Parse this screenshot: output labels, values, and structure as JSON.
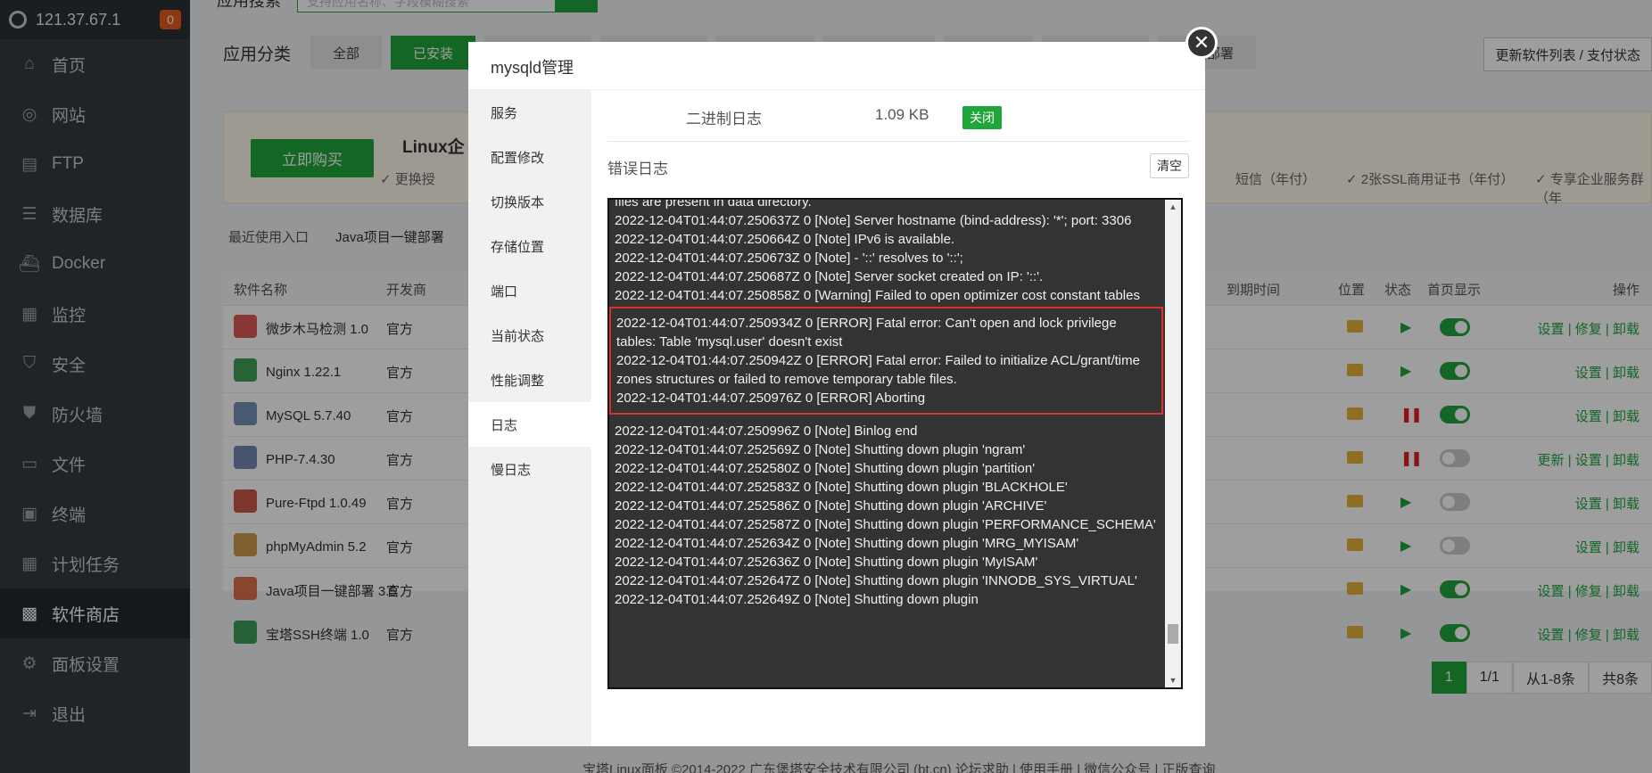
{
  "sidebar": {
    "ip": "121.37.67.1",
    "badge": "0",
    "items": [
      {
        "label": "首页",
        "icon": "home-icon"
      },
      {
        "label": "网站",
        "icon": "globe-icon"
      },
      {
        "label": "FTP",
        "icon": "ftp-icon"
      },
      {
        "label": "数据库",
        "icon": "database-icon"
      },
      {
        "label": "Docker",
        "icon": "docker-icon"
      },
      {
        "label": "监控",
        "icon": "monitor-icon"
      },
      {
        "label": "安全",
        "icon": "shield-check-icon"
      },
      {
        "label": "防火墙",
        "icon": "firewall-icon"
      },
      {
        "label": "文件",
        "icon": "folder-icon"
      },
      {
        "label": "终端",
        "icon": "terminal-icon"
      },
      {
        "label": "计划任务",
        "icon": "calendar-icon"
      },
      {
        "label": "软件商店",
        "icon": "grid-icon"
      },
      {
        "label": "面板设置",
        "icon": "gear-icon"
      },
      {
        "label": "退出",
        "icon": "logout-icon"
      }
    ]
  },
  "page": {
    "search_label": "应用搜索",
    "search_placeholder": "支持应用名称、字段模糊搜索",
    "category_label": "应用分类",
    "categories": [
      "全部",
      "已安装",
      "",
      "",
      "",
      "",
      "",
      "",
      "一键部署"
    ],
    "update_button": "更新软件列表 / 支付状态",
    "promo": {
      "buy": "立即购买",
      "title": "Linux企",
      "feat1": "✓ 更换授",
      "feat2": "短信（年付）",
      "feat3": "✓ 2张SSL商用证书（年付）",
      "feat4": "✓ 专享企业服务群（年"
    },
    "recent_label": "最近使用入口",
    "recent_item": "Java项目一键部署",
    "table": {
      "headers": {
        "name": "软件名称",
        "dev": "开发商",
        "expire": "到期时间",
        "pos": "位置",
        "state": "状态",
        "home": "首页显示",
        "ops": "操作"
      },
      "rows": [
        {
          "name": "微步木马检测 1.0",
          "dev": "官方",
          "running": true,
          "home": true,
          "ops": "设置 | 修复 | 卸载"
        },
        {
          "name": "Nginx 1.22.1",
          "dev": "官方",
          "running": true,
          "home": true,
          "ops": "设置 | 卸载"
        },
        {
          "name": "MySQL 5.7.40",
          "dev": "官方",
          "running": false,
          "home": true,
          "ops": "设置 | 卸载"
        },
        {
          "name": "PHP-7.4.30",
          "dev": "官方",
          "running": false,
          "home": false,
          "ops": "更新 | 设置 | 卸载"
        },
        {
          "name": "Pure-Ftpd 1.0.49",
          "dev": "官方",
          "running": true,
          "home": false,
          "ops": "设置 | 卸载"
        },
        {
          "name": "phpMyAdmin 5.2",
          "dev": "官方",
          "running": true,
          "home": false,
          "ops": "设置 | 卸载"
        },
        {
          "name": "Java项目一键部署 3.5",
          "dev": "官方",
          "running": true,
          "home": true,
          "ops": "设置 | 修复 | 卸载"
        },
        {
          "name": "宝塔SSH终端 1.0",
          "dev": "官方",
          "running": true,
          "home": true,
          "ops": "设置 | 修复 | 卸载"
        }
      ]
    },
    "pager": {
      "current": "1",
      "total": "1/1",
      "range": "从1-8条",
      "count": "共8条"
    },
    "footer": "宝塔Linux面板 ©2014-2022 广东堡塔安全技术有限公司 (bt.cn)   论坛求助 | 使用手册 | 微信公众号 | 正版查询"
  },
  "modal": {
    "title": "mysqld管理",
    "tabs": [
      "服务",
      "配置修改",
      "切换版本",
      "存储位置",
      "端口",
      "当前状态",
      "性能调整",
      "日志",
      "慢日志"
    ],
    "binlog_label": "二进制日志",
    "binlog_size": "1.09 KB",
    "binlog_status": "关闭",
    "errlog_label": "错误日志",
    "clear_button": "清空",
    "log_before": [
      "files are present in data directory.",
      "2022-12-04T01:44:07.250637Z 0 [Note] Server hostname (bind-address): '*'; port: 3306",
      "2022-12-04T01:44:07.250664Z 0 [Note] IPv6 is available.",
      "2022-12-04T01:44:07.250673Z 0 [Note]   - '::' resolves to '::';",
      "2022-12-04T01:44:07.250687Z 0 [Note] Server socket created on IP: '::'.",
      "2022-12-04T01:44:07.250858Z 0 [Warning] Failed to open optimizer cost constant tables"
    ],
    "log_error": [
      "2022-12-04T01:44:07.250934Z 0 [ERROR] Fatal error: Can't open and lock privilege tables: Table 'mysql.user' doesn't exist",
      "2022-12-04T01:44:07.250942Z 0 [ERROR] Fatal error: Failed to initialize ACL/grant/time zones structures or failed to remove temporary table files.",
      "2022-12-04T01:44:07.250976Z 0 [ERROR] Aborting"
    ],
    "log_after": [
      "2022-12-04T01:44:07.250996Z 0 [Note] Binlog end",
      "2022-12-04T01:44:07.252569Z 0 [Note] Shutting down plugin 'ngram'",
      "2022-12-04T01:44:07.252580Z 0 [Note] Shutting down plugin 'partition'",
      "2022-12-04T01:44:07.252583Z 0 [Note] Shutting down plugin 'BLACKHOLE'",
      "2022-12-04T01:44:07.252586Z 0 [Note] Shutting down plugin 'ARCHIVE'",
      "2022-12-04T01:44:07.252587Z 0 [Note] Shutting down plugin 'PERFORMANCE_SCHEMA'",
      "2022-12-04T01:44:07.252634Z 0 [Note] Shutting down plugin 'MRG_MYISAM'",
      "2022-12-04T01:44:07.252636Z 0 [Note] Shutting down plugin 'MyISAM'",
      "2022-12-04T01:44:07.252647Z 0 [Note] Shutting down plugin 'INNODB_SYS_VIRTUAL'",
      "2022-12-04T01:44:07.252649Z 0 [Note] Shutting down plugin"
    ]
  },
  "colors": {
    "brand": "#20a53a",
    "sidebar": "#333a3f",
    "error_border": "#e02e2e"
  }
}
